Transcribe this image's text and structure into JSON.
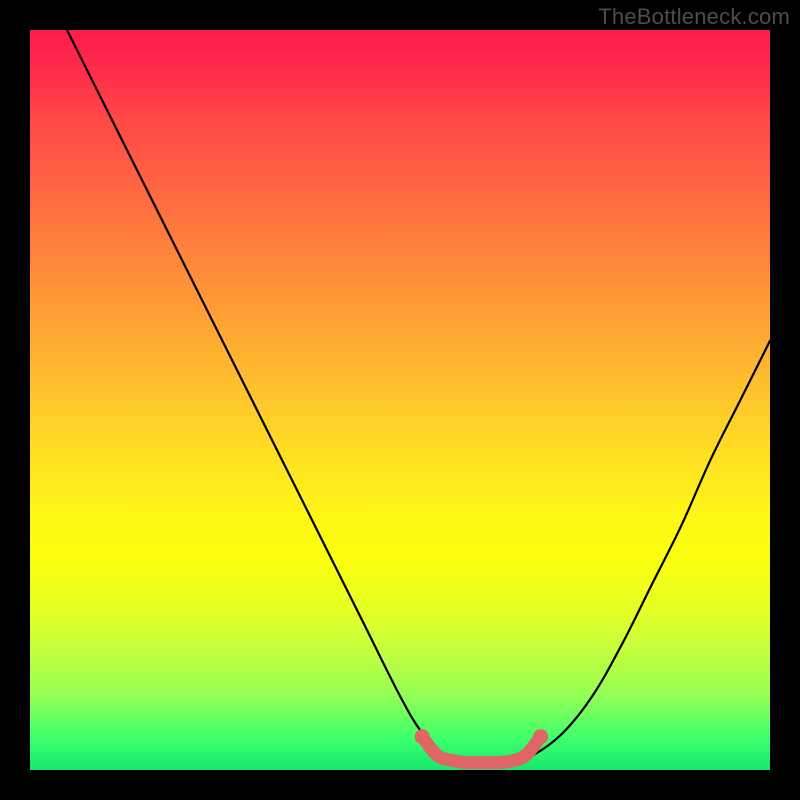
{
  "watermark": "TheBottleneck.com",
  "colors": {
    "frame": "#000000",
    "curve": "#000000",
    "marker": "#e06666",
    "gradient_top": "#ff1a4d",
    "gradient_bottom": "#17e86d"
  },
  "chart_data": {
    "type": "line",
    "title": "",
    "xlabel": "",
    "ylabel": "",
    "xlim": [
      0,
      100
    ],
    "ylim": [
      0,
      100
    ],
    "grid": false,
    "legend": false,
    "series": [
      {
        "name": "curve",
        "x": [
          5,
          10,
          15,
          20,
          25,
          30,
          35,
          40,
          45,
          50,
          53,
          56,
          59,
          62,
          65,
          68,
          72,
          76,
          80,
          84,
          88,
          92,
          96,
          100
        ],
        "y": [
          100,
          90,
          80,
          70,
          60,
          50,
          40,
          30,
          20,
          10,
          5,
          2,
          1,
          1,
          1,
          2,
          5,
          10,
          17,
          25,
          33,
          42,
          50,
          58
        ]
      }
    ],
    "markers": {
      "name": "bottom-band",
      "x": [
        53,
        55,
        57,
        59,
        61,
        63,
        65,
        67,
        69
      ],
      "y": [
        4.5,
        2.0,
        1.3,
        1.0,
        1.0,
        1.0,
        1.2,
        2.0,
        4.5
      ]
    }
  }
}
